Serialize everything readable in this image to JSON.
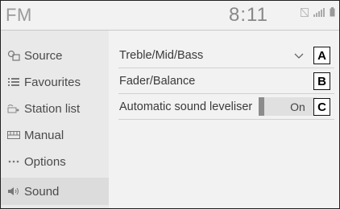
{
  "header": {
    "title": "FM",
    "time": "8:11"
  },
  "sidebar": {
    "items": [
      {
        "label": "Source",
        "icon": "source-icon"
      },
      {
        "label": "Favourites",
        "icon": "list-icon"
      },
      {
        "label": "Station list",
        "icon": "station-list-icon"
      },
      {
        "label": "Manual",
        "icon": "manual-icon"
      },
      {
        "label": "Options",
        "icon": "ellipsis-icon"
      },
      {
        "label": "Sound",
        "icon": "speaker-icon",
        "active": true
      }
    ]
  },
  "main": {
    "rows": [
      {
        "label": "Treble/Mid/Bass",
        "control": "chevron-down-icon"
      },
      {
        "label": "Fader/Balance"
      },
      {
        "label": "Automatic sound leveliser",
        "toggle": "On"
      }
    ]
  },
  "callouts": [
    "A",
    "B",
    "C"
  ]
}
